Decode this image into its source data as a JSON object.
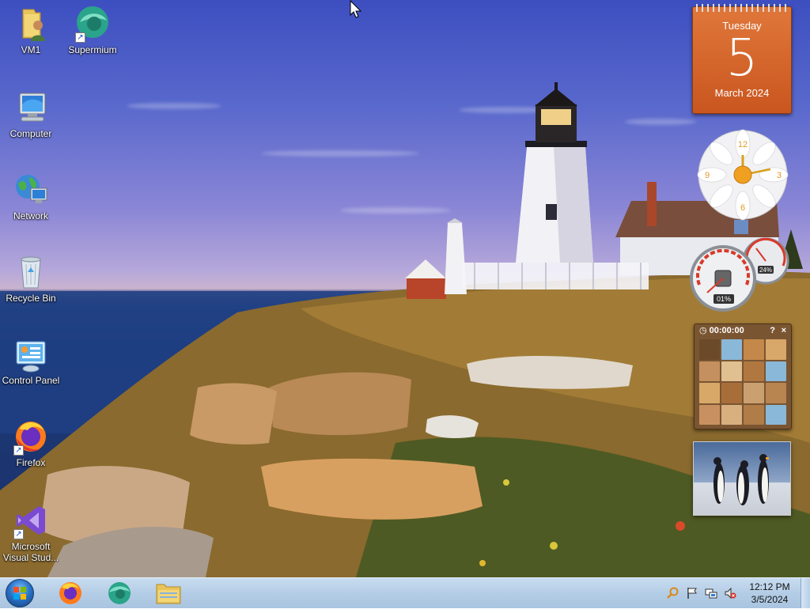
{
  "desktop": {
    "icons": [
      {
        "label": "VM1",
        "icon": "user-folder-icon"
      },
      {
        "label": "Supermium",
        "icon": "supermium-icon"
      },
      {
        "label": "Computer",
        "icon": "computer-icon"
      },
      {
        "label": "Network",
        "icon": "network-icon"
      },
      {
        "label": "Recycle Bin",
        "icon": "recycle-bin-icon"
      },
      {
        "label": "Control Panel",
        "icon": "control-panel-icon"
      },
      {
        "label": "Firefox",
        "icon": "firefox-icon"
      },
      {
        "label": "Microsoft Visual Stud...",
        "label_line1": "Microsoft",
        "label_line2": "Visual Stud...",
        "icon": "visual-studio-icon"
      }
    ]
  },
  "gadgets": {
    "calendar": {
      "weekday": "Tuesday",
      "day": "5",
      "month_year": "March 2024"
    },
    "clock": {
      "numerals": [
        "12",
        "3",
        "6",
        "9"
      ]
    },
    "cpu_meter": {
      "cpu": "01%",
      "memory": "24%",
      "cpu_value": 1,
      "memory_value": 24
    },
    "puzzle": {
      "timer": "00:00:00",
      "help": "?",
      "close": "×"
    },
    "slideshow": {
      "subject": "penguins"
    }
  },
  "taskbar": {
    "pinned": [
      {
        "name": "Firefox",
        "icon": "firefox-icon"
      },
      {
        "name": "Supermium",
        "icon": "supermium-icon"
      },
      {
        "name": "File Explorer",
        "icon": "folder-icon"
      }
    ],
    "tray": {
      "icons": [
        "search-icon",
        "flag-icon",
        "network-icon",
        "volume-muted-icon"
      ],
      "time": "12:12 PM",
      "date": "3/5/2024"
    }
  },
  "colors": {
    "taskbar": "#b4cde6",
    "calendar": "#d9672c"
  }
}
